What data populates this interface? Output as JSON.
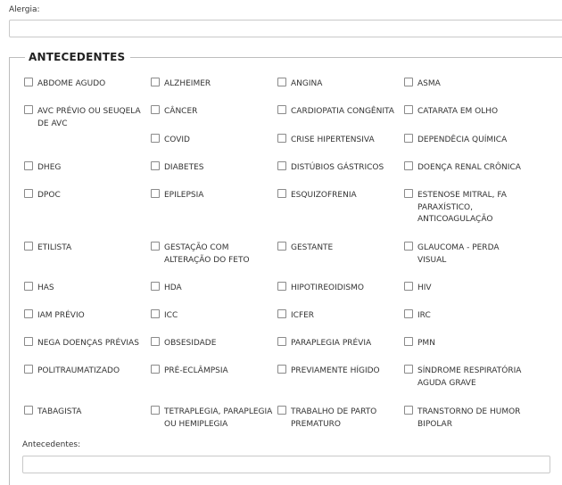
{
  "alergia": {
    "label": "Alergia:",
    "value": ""
  },
  "antecedentes_section": {
    "title": "ANTECEDENTES",
    "options": [
      {
        "label": "ABDOME AGUDO",
        "checked": false
      },
      {
        "label": "ALZHEIMER",
        "checked": false
      },
      {
        "label": "ANGINA",
        "checked": false
      },
      {
        "label": "ASMA",
        "checked": false
      },
      {
        "label": "AVC PRÉVIO OU SEUQELA DE AVC",
        "checked": false
      },
      {
        "label": "CÂNCER",
        "checked": false
      },
      {
        "label": "CARDIOPATIA CONGÊNITA",
        "checked": false
      },
      {
        "label": "CATARATA EM OLHO",
        "checked": false
      },
      {
        "label": "COVID",
        "checked": false
      },
      {
        "label": "CRISE HIPERTENSIVA",
        "checked": false
      },
      {
        "label": "DEPENDÊCIA QUÍMICA",
        "checked": false
      },
      {
        "label": "DHEG",
        "checked": false
      },
      {
        "label": "DIABETES",
        "checked": false
      },
      {
        "label": "DISTÚBIOS GÁSTRICOS",
        "checked": false
      },
      {
        "label": "DOENÇA RENAL CRÔNICA",
        "checked": false
      },
      {
        "label": "DPOC",
        "checked": false
      },
      {
        "label": "EPILEPSIA",
        "checked": false
      },
      {
        "label": "ESQUIZOFRENIA",
        "checked": false
      },
      {
        "label": "ESTENOSE MITRAL, FA PARAXÍSTICO, ANTICOAGULAÇÃO",
        "checked": false
      },
      {
        "label": "ETILISTA",
        "checked": false
      },
      {
        "label": "GESTAÇÃO COM ALTERAÇÃO DO FETO",
        "checked": false
      },
      {
        "label": "GESTANTE",
        "checked": false
      },
      {
        "label": "GLAUCOMA - PERDA VISUAL",
        "checked": false
      },
      {
        "label": "HAS",
        "checked": false
      },
      {
        "label": "HDA",
        "checked": false
      },
      {
        "label": "HIPOTIREOIDISMO",
        "checked": false
      },
      {
        "label": "HIV",
        "checked": false
      },
      {
        "label": "IAM PRÉVIO",
        "checked": false
      },
      {
        "label": "ICC",
        "checked": false
      },
      {
        "label": "ICFER",
        "checked": false
      },
      {
        "label": "IRC",
        "checked": false
      },
      {
        "label": "NEGA DOENÇAS PRÉVIAS",
        "checked": false
      },
      {
        "label": "OBSESIDADE",
        "checked": false
      },
      {
        "label": "PARAPLEGIA PRÉVIA",
        "checked": false
      },
      {
        "label": "PMN",
        "checked": false
      },
      {
        "label": "POLITRAUMATIZADO",
        "checked": false
      },
      {
        "label": "PRÉ-ECLÂMPSIA",
        "checked": false
      },
      {
        "label": "PREVIAMENTE HÍGIDO",
        "checked": false
      },
      {
        "label": "SÍNDROME RESPIRATÓRIA AGUDA GRAVE",
        "checked": false
      },
      {
        "label": "TABAGISTA",
        "checked": false
      },
      {
        "label": "TETRAPLEGIA, PARAPLEGIA OU HEMIPLEGIA",
        "checked": false
      },
      {
        "label": "TRABALHO DE PARTO PREMATURO",
        "checked": false
      },
      {
        "label": "TRANSTORNO DE HUMOR BIPOLAR",
        "checked": false
      }
    ],
    "notes": {
      "label": "Antecedentes:",
      "value": ""
    }
  }
}
